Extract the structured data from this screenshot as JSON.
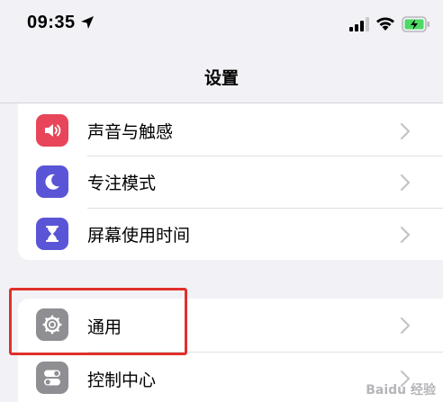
{
  "status_bar": {
    "time": "09:35",
    "location_icon": "location-arrow-icon",
    "signal_icon": "cellular-signal-icon",
    "wifi_icon": "wifi-icon",
    "battery_icon": "battery-charging-icon"
  },
  "nav": {
    "title": "设置"
  },
  "group1": {
    "items": [
      {
        "label": "声音与触感",
        "icon": "speaker-icon",
        "color": "#e8455a"
      },
      {
        "label": "专注模式",
        "icon": "moon-icon",
        "color": "#5a55d6"
      },
      {
        "label": "屏幕使用时间",
        "icon": "hourglass-icon",
        "color": "#5a55d6"
      }
    ]
  },
  "group2": {
    "items": [
      {
        "label": "通用",
        "icon": "gear-icon",
        "color": "#8e8e93"
      },
      {
        "label": "控制中心",
        "icon": "toggles-icon",
        "color": "#8e8e93"
      }
    ]
  },
  "annotation": {
    "color": "#e0302b"
  },
  "watermark": {
    "text": "Baidu 经验"
  }
}
